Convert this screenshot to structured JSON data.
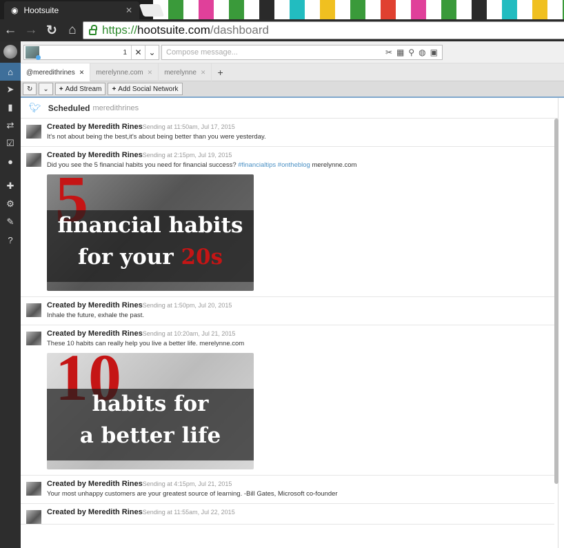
{
  "browser": {
    "tab_title": "Hootsuite",
    "url_scheme": "https://",
    "url_host": "hootsuite.com",
    "url_path": "/dashboard"
  },
  "stripe_colors": [
    "#1e1e1e",
    "#ffffff",
    "#3a9a3a",
    "#ffffff",
    "#e0409a",
    "#ffffff",
    "#3a9a3a",
    "#ffffff",
    "#2a2a2a",
    "#ffffff",
    "#22bcc0",
    "#ffffff",
    "#f0c020",
    "#ffffff",
    "#3a9a3a",
    "#ffffff",
    "#e04030",
    "#ffffff",
    "#e0409a",
    "#ffffff",
    "#3a9a3a",
    "#ffffff",
    "#2a2a2a",
    "#ffffff",
    "#22bcc0",
    "#ffffff",
    "#f0c020",
    "#ffffff",
    "#3a9a3a"
  ],
  "compose": {
    "profile_count": "1",
    "placeholder": "Compose message..."
  },
  "stream_tabs": [
    {
      "label": "@meredithrines",
      "active": true
    },
    {
      "label": "merelynne.com",
      "active": false
    },
    {
      "label": "merelynne",
      "active": false
    }
  ],
  "toolbar": {
    "add_stream": "Add Stream",
    "add_social_network": "Add Social Network"
  },
  "column": {
    "title": "Scheduled",
    "account": "meredithrines"
  },
  "messages": [
    {
      "author": "Created by Meredith Rines",
      "when": "Sending at 11:50am, Jul 17, 2015",
      "text": "It's not about being the best,it's about being better than you were yesterday."
    },
    {
      "author": "Created by Meredith Rines",
      "when": "Sending at 2:15pm, Jul 19, 2015",
      "text": "Did you see the 5 financial habits you need for financial success?",
      "tags": "#financialtips #ontheblog",
      "text_suffix": "merelynne.com",
      "image": {
        "number": "5",
        "line1": "financial habits",
        "line2a": "for your ",
        "line2b": "20s"
      }
    },
    {
      "author": "Created by Meredith Rines",
      "when": "Sending at 1:50pm, Jul 20, 2015",
      "text": "Inhale the future, exhale the past."
    },
    {
      "author": "Created by Meredith Rines",
      "when": "Sending at 10:20am, Jul 21, 2015",
      "text": "These 10 habits can really help you live a better life. merelynne.com",
      "image": {
        "number": "10",
        "line1": "habits for",
        "line2a": "a better life",
        "line2b": ""
      }
    },
    {
      "author": "Created by Meredith Rines",
      "when": "Sending at 4:15pm, Jul 21, 2015",
      "text": "Your most unhappy customers are your greatest source of learning. -Bill Gates, Microsoft co-founder"
    },
    {
      "author": "Created by Meredith Rines",
      "when": "Sending at 11:55am, Jul 22, 2015",
      "text": ""
    }
  ]
}
